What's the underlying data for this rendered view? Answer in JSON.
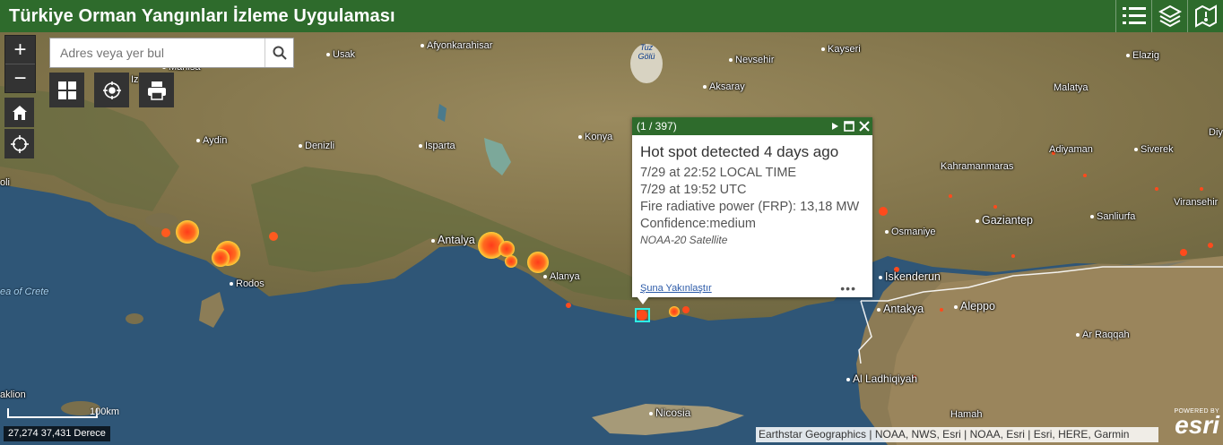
{
  "header": {
    "title": "Türkiye Orman Yangınları İzleme Uygulaması"
  },
  "search": {
    "placeholder": "Adres veya yer bul"
  },
  "zoom": {
    "in": "+",
    "out": "−"
  },
  "places": [
    {
      "name": "Afyonkarahisar"
    },
    {
      "name": "Usak"
    },
    {
      "name": "Manisa"
    },
    {
      "name": "Iz"
    },
    {
      "name": "Aydin"
    },
    {
      "name": "Denizli"
    },
    {
      "name": "Isparta"
    },
    {
      "name": "oli"
    },
    {
      "name": "Konya"
    },
    {
      "name": "Tuz Gölü"
    },
    {
      "name": "Nevsehir"
    },
    {
      "name": "Kayseri"
    },
    {
      "name": "Aksaray"
    },
    {
      "name": "Elazig"
    },
    {
      "name": "Malatya"
    },
    {
      "name": "Adiyaman"
    },
    {
      "name": "Siverek"
    },
    {
      "name": "Diy"
    },
    {
      "name": "Kahramanmaras"
    },
    {
      "name": "Viransehir"
    },
    {
      "name": "Gaziantep"
    },
    {
      "name": "Sanliurfa"
    },
    {
      "name": "Osmaniye"
    },
    {
      "name": "Antalya"
    },
    {
      "name": "Alanya"
    },
    {
      "name": "Rodos"
    },
    {
      "name": "ea of Crete"
    },
    {
      "name": "Iskenderun"
    },
    {
      "name": "Antakya"
    },
    {
      "name": "Aleppo"
    },
    {
      "name": "Ar Raqqah"
    },
    {
      "name": "Al Ladhiqiyah"
    },
    {
      "name": "Hamah"
    },
    {
      "name": "Nicosia"
    },
    {
      "name": "aklion"
    }
  ],
  "popup": {
    "counter": "(1 / 397)",
    "title": "Hot spot detected 4 days ago",
    "local_time": "7/29 at 22:52 LOCAL TIME",
    "utc_time": "7/29 at 19:52 UTC",
    "frp": "Fire radiative power (FRP): 13,18 MW",
    "confidence": "Confidence:medium",
    "satellite": "NOAA-20 Satellite",
    "zoom_link": "Şuna Yakınlaştır",
    "more": "•••"
  },
  "footer": {
    "attribution": "Earthstar Geographics | NOAA, NWS, Esri | NOAA, Esri | Esri, HERE, Garmin",
    "coordinates": "27,274 37,431 Derece",
    "scale": "100km",
    "powered_by": "POWERED BY",
    "esri_logo": "esri"
  },
  "colors": {
    "header_bg": "#2e6b2c",
    "fire": "#ff4a1c",
    "fire_glow": "#ffd23a"
  },
  "icons": [
    "list-icon",
    "layers-icon",
    "map-legend-icon",
    "search-icon",
    "home-icon",
    "locate-icon",
    "basemap-gallery-icon",
    "filter-icon",
    "print-icon",
    "play-icon",
    "maximize-icon",
    "close-icon"
  ]
}
